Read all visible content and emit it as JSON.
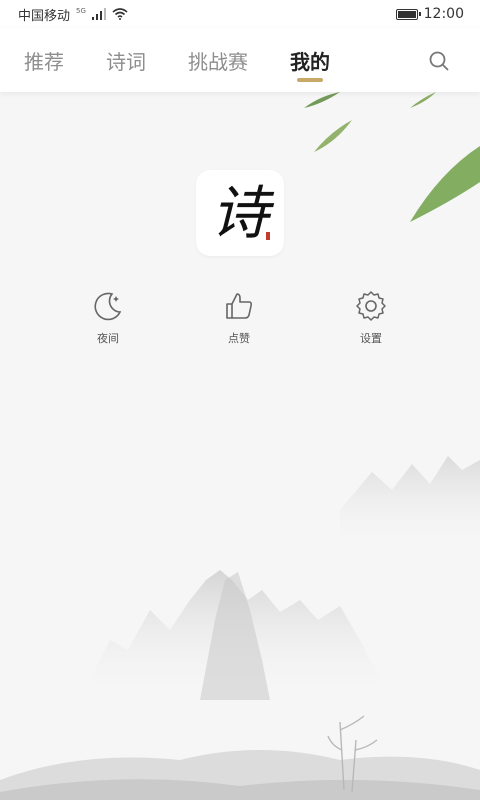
{
  "status_bar": {
    "carrier": "中国移动",
    "network": "5G",
    "time": "12:00",
    "battery_level": 1.0
  },
  "tabs": [
    {
      "label": "推荐",
      "active": false
    },
    {
      "label": "诗词",
      "active": false
    },
    {
      "label": "挑战赛",
      "active": false
    },
    {
      "label": "我的",
      "active": true
    }
  ],
  "logo": {
    "glyph": "诗"
  },
  "actions": [
    {
      "label": "夜间",
      "icon": "moon-icon"
    },
    {
      "label": "点赞",
      "icon": "thumbs-up-icon"
    },
    {
      "label": "设置",
      "icon": "gear-icon"
    }
  ],
  "colors": {
    "tab_active_underline": "#c8a96a",
    "tab_inactive": "#8e8e8e",
    "tab_active": "#222222",
    "background": "#f6f6f6",
    "seal_red": "#c43a2e"
  }
}
